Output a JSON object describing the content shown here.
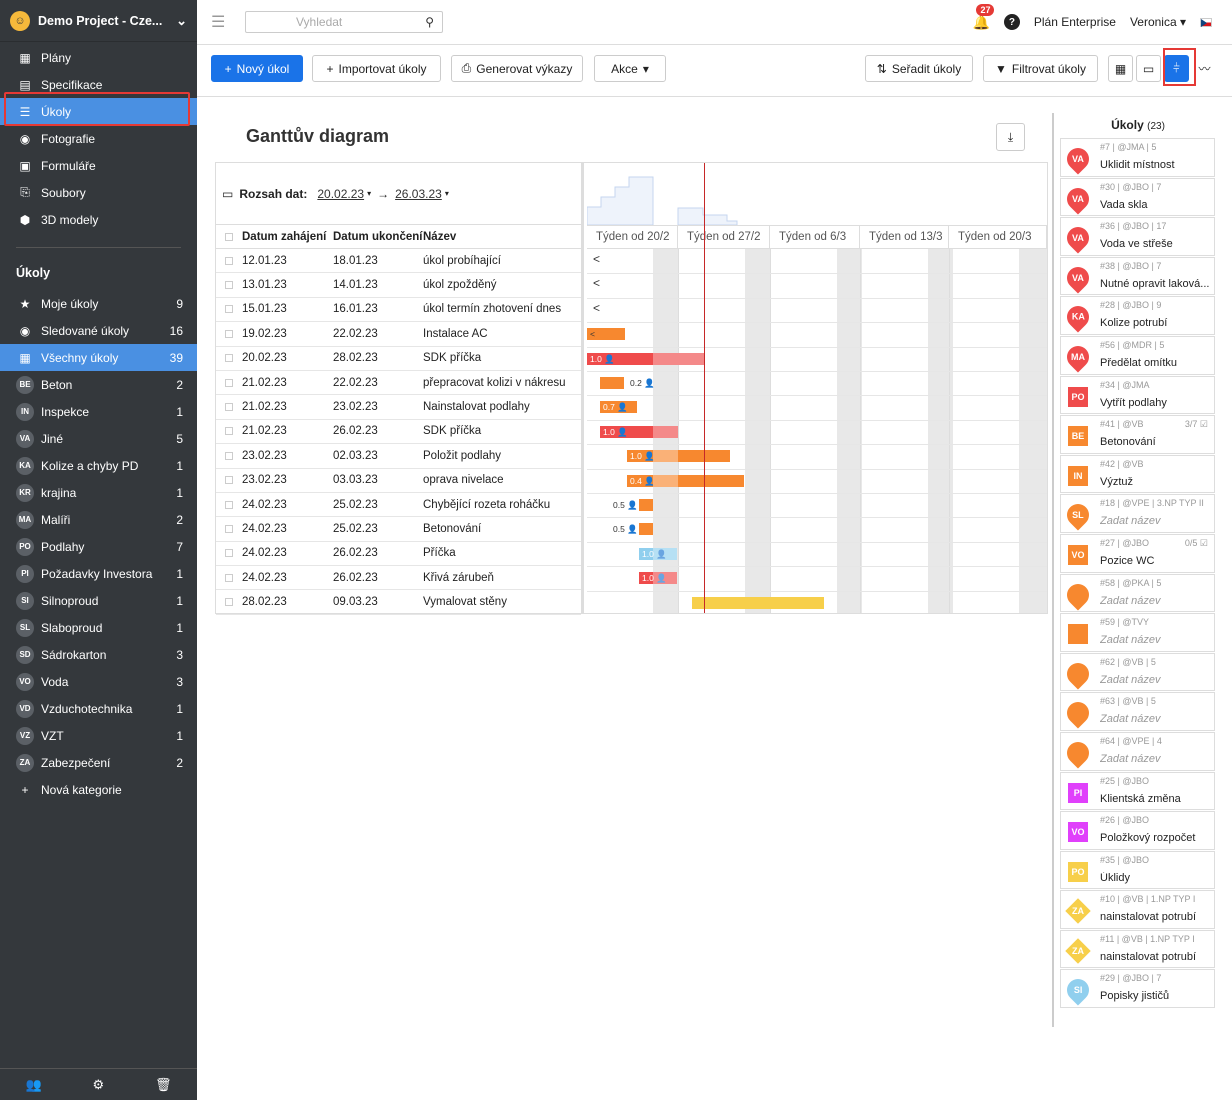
{
  "project": {
    "name": "Demo Project - Cze..."
  },
  "nav": [
    {
      "icon": "▦",
      "label": "Plány"
    },
    {
      "icon": "▤",
      "label": "Specifikace"
    },
    {
      "icon": "☰",
      "label": "Úkoly"
    },
    {
      "icon": "◉",
      "label": "Fotografie"
    },
    {
      "icon": "▣",
      "label": "Formuláře"
    },
    {
      "icon": "⎘",
      "label": "Soubory"
    },
    {
      "icon": "⬢",
      "label": "3D modely"
    }
  ],
  "tasks_section": "Úkoly",
  "task_nav": [
    {
      "icon": "★",
      "label": "Moje úkoly",
      "count": "9"
    },
    {
      "icon": "◉",
      "label": "Sledované úkoly",
      "count": "16"
    },
    {
      "icon": "▦",
      "label": "Všechny úkoly",
      "count": "39"
    }
  ],
  "categories": [
    {
      "code": "BE",
      "label": "Beton",
      "count": "2"
    },
    {
      "code": "IN",
      "label": "Inspekce",
      "count": "1"
    },
    {
      "code": "VA",
      "label": "Jiné",
      "count": "5"
    },
    {
      "code": "KA",
      "label": "Kolize a chyby PD",
      "count": "1"
    },
    {
      "code": "KR",
      "label": "krajina",
      "count": "1"
    },
    {
      "code": "MA",
      "label": "Malíři",
      "count": "2"
    },
    {
      "code": "PO",
      "label": "Podlahy",
      "count": "7"
    },
    {
      "code": "PI",
      "label": "Požadavky Investora",
      "count": "1"
    },
    {
      "code": "SI",
      "label": "Silnoproud",
      "count": "1"
    },
    {
      "code": "SL",
      "label": "Slaboproud",
      "count": "1"
    },
    {
      "code": "SD",
      "label": "Sádrokarton",
      "count": "3"
    },
    {
      "code": "VO",
      "label": "Voda",
      "count": "3"
    },
    {
      "code": "VD",
      "label": "Vzduchotechnika",
      "count": "1"
    },
    {
      "code": "VZ",
      "label": "VZT",
      "count": "1"
    },
    {
      "code": "ZA",
      "label": "Zabezpečení",
      "count": "2"
    }
  ],
  "new_category": "Nová kategorie",
  "topbar": {
    "search_placeholder": "Vyhledat",
    "notifications": "27",
    "plan": "Plán Enterprise",
    "user": "Veronica"
  },
  "toolbar": {
    "new_task": "Nový úkol",
    "import": "Importovat úkoly",
    "report": "Generovat výkazy",
    "actions": "Akce",
    "sort": "Seřadit úkoly",
    "filter": "Filtrovat úkoly"
  },
  "gantt": {
    "title": "Ganttův diagram",
    "range_label": "Rozsah dat:",
    "range_from": "20.02.23",
    "range_to": "26.03.23",
    "columns": [
      "Datum zahájení",
      "Datum ukončení",
      "Název"
    ],
    "weeks": [
      "Týden od 20/2",
      "Týden od 27/2",
      "Týden od 6/3",
      "Týden od 13/3",
      "Týden od 20/3"
    ],
    "rows": [
      {
        "start": "12.01.23",
        "end": "18.01.23",
        "name": "úkol probíhající"
      },
      {
        "start": "13.01.23",
        "end": "14.01.23",
        "name": "úkol zpožděný"
      },
      {
        "start": "15.01.23",
        "end": "16.01.23",
        "name": "úkol termín zhotovení dnes"
      },
      {
        "start": "19.02.23",
        "end": "22.02.23",
        "name": "Instalace AC"
      },
      {
        "start": "20.02.23",
        "end": "28.02.23",
        "name": "SDK příčka"
      },
      {
        "start": "21.02.23",
        "end": "22.02.23",
        "name": "přepracovat kolizi v nákresu"
      },
      {
        "start": "21.02.23",
        "end": "23.02.23",
        "name": "Nainstalovat podlahy"
      },
      {
        "start": "21.02.23",
        "end": "26.02.23",
        "name": "SDK příčka"
      },
      {
        "start": "23.02.23",
        "end": "02.03.23",
        "name": "Položit podlahy"
      },
      {
        "start": "23.02.23",
        "end": "03.03.23",
        "name": "oprava nivelace"
      },
      {
        "start": "24.02.23",
        "end": "25.02.23",
        "name": "Chybějící rozeta roháčku"
      },
      {
        "start": "24.02.23",
        "end": "25.02.23",
        "name": "Betonování"
      },
      {
        "start": "24.02.23",
        "end": "26.02.23",
        "name": "Příčka"
      },
      {
        "start": "24.02.23",
        "end": "26.02.23",
        "name": "Křivá zárubeň"
      },
      {
        "start": "28.02.23",
        "end": "09.03.23",
        "name": "Vymalovat stěny"
      }
    ],
    "bars": [
      {
        "type": "arrow",
        "label": "<"
      },
      {
        "type": "arrow",
        "label": "<"
      },
      {
        "type": "arrow",
        "label": "<"
      },
      {
        "color": "#f7882f",
        "label": "<"
      },
      {
        "color": "#ef4b4b",
        "label": "1.0 👤"
      },
      {
        "color": "#f7882f",
        "label": "",
        "outside": "0.2 👤"
      },
      {
        "color": "#f7882f",
        "label": "0.7 👤"
      },
      {
        "color": "#ef4b4b",
        "label": "1.0 👤"
      },
      {
        "color": "#f7882f",
        "label": "1.0 👤"
      },
      {
        "color": "#f7882f",
        "label": "0.4 👤"
      },
      {
        "color": "#f7882f",
        "label": "",
        "outside": "0.5 👤"
      },
      {
        "color": "#f7882f",
        "label": "",
        "outside": "0.5 👤"
      },
      {
        "color": "#90cfee",
        "label": "1.0 👤"
      },
      {
        "color": "#ef4b4b",
        "label": "1.0 👤"
      },
      {
        "color": "#f7cf4a",
        "label": ""
      }
    ]
  },
  "panel": {
    "title": "Úkoly",
    "count": "(23)",
    "cards": [
      {
        "code": "VA",
        "shape": "pin",
        "color": "#ef4b4b",
        "meta": "#7 | @JMA | 5",
        "name": "Uklidit místnost",
        "extra": ""
      },
      {
        "code": "VA",
        "shape": "pin",
        "color": "#ef4b4b",
        "meta": "#30 | @JBO | 7",
        "name": "Vada skla",
        "extra": ""
      },
      {
        "code": "VA",
        "shape": "pin",
        "color": "#ef4b4b",
        "meta": "#36 | @JBO | 17",
        "name": "Voda ve střeše",
        "extra": ""
      },
      {
        "code": "VA",
        "shape": "pin",
        "color": "#ef4b4b",
        "meta": "#38 | @JBO | 7",
        "name": "Nutné opravit laková...",
        "extra": ""
      },
      {
        "code": "KA",
        "shape": "pin",
        "color": "#ef4b4b",
        "meta": "#28 | @JBO | 9",
        "name": "Kolize potrubí",
        "extra": ""
      },
      {
        "code": "MA",
        "shape": "pin",
        "color": "#ef4b4b",
        "meta": "#56 | @MDR | 5",
        "name": "Předělat omítku",
        "extra": ""
      },
      {
        "code": "PO",
        "shape": "sq",
        "color": "#ef4b4b",
        "meta": "#34 | @JMA",
        "name": "Vytřít podlahy",
        "extra": ""
      },
      {
        "code": "BE",
        "shape": "sq",
        "color": "#f7882f",
        "meta": "#41 | @VB",
        "name": "Betonování",
        "extra": "3/7 ☑"
      },
      {
        "code": "IN",
        "shape": "sq",
        "color": "#f7882f",
        "meta": "#42 | @VB",
        "name": "Výztuž",
        "extra": ""
      },
      {
        "code": "SL",
        "shape": "pin",
        "color": "#f7882f",
        "meta": "#18 | @VPE | 3.NP TYP II",
        "name": "Zadat název",
        "extra": ""
      },
      {
        "code": "VO",
        "shape": "sq",
        "color": "#f7882f",
        "meta": "#27 | @JBO",
        "name": "Pozice WC",
        "extra": "0/5 ☑"
      },
      {
        "code": "",
        "shape": "pin",
        "color": "#f7882f",
        "meta": "#58 | @PKA | 5",
        "name": "Zadat název",
        "extra": ""
      },
      {
        "code": "",
        "shape": "sq",
        "color": "#f7882f",
        "meta": "#59 | @TVY",
        "name": "Zadat název",
        "extra": ""
      },
      {
        "code": "",
        "shape": "pin",
        "color": "#f7882f",
        "meta": "#62 | @VB | 5",
        "name": "Zadat název",
        "extra": ""
      },
      {
        "code": "",
        "shape": "pin",
        "color": "#f7882f",
        "meta": "#63 | @VB | 5",
        "name": "Zadat název",
        "extra": ""
      },
      {
        "code": "",
        "shape": "pin",
        "color": "#f7882f",
        "meta": "#64 | @VPE | 4",
        "name": "Zadat název",
        "extra": ""
      },
      {
        "code": "PI",
        "shape": "sq",
        "color": "#e040fb",
        "meta": "#25 | @JBO",
        "name": "Klientská změna",
        "extra": ""
      },
      {
        "code": "VO",
        "shape": "sq",
        "color": "#e040fb",
        "meta": "#26 | @JBO",
        "name": "Položkový rozpočet",
        "extra": ""
      },
      {
        "code": "PO",
        "shape": "sq",
        "color": "#f7cf4a",
        "meta": "#35 | @JBO",
        "name": "Úklidy",
        "extra": ""
      },
      {
        "code": "ZA",
        "shape": "dia",
        "color": "#f7cf4a",
        "meta": "#10 | @VB | 1.NP TYP I",
        "name": "nainstalovat potrubí",
        "extra": ""
      },
      {
        "code": "ZA",
        "shape": "dia",
        "color": "#f7cf4a",
        "meta": "#11 | @VB | 1.NP TYP I",
        "name": "nainstalovat potrubí",
        "extra": ""
      },
      {
        "code": "SI",
        "shape": "pin",
        "color": "#90cfee",
        "meta": "#29 | @JBO | 7",
        "name": "Popisky jističů",
        "extra": ""
      }
    ]
  }
}
